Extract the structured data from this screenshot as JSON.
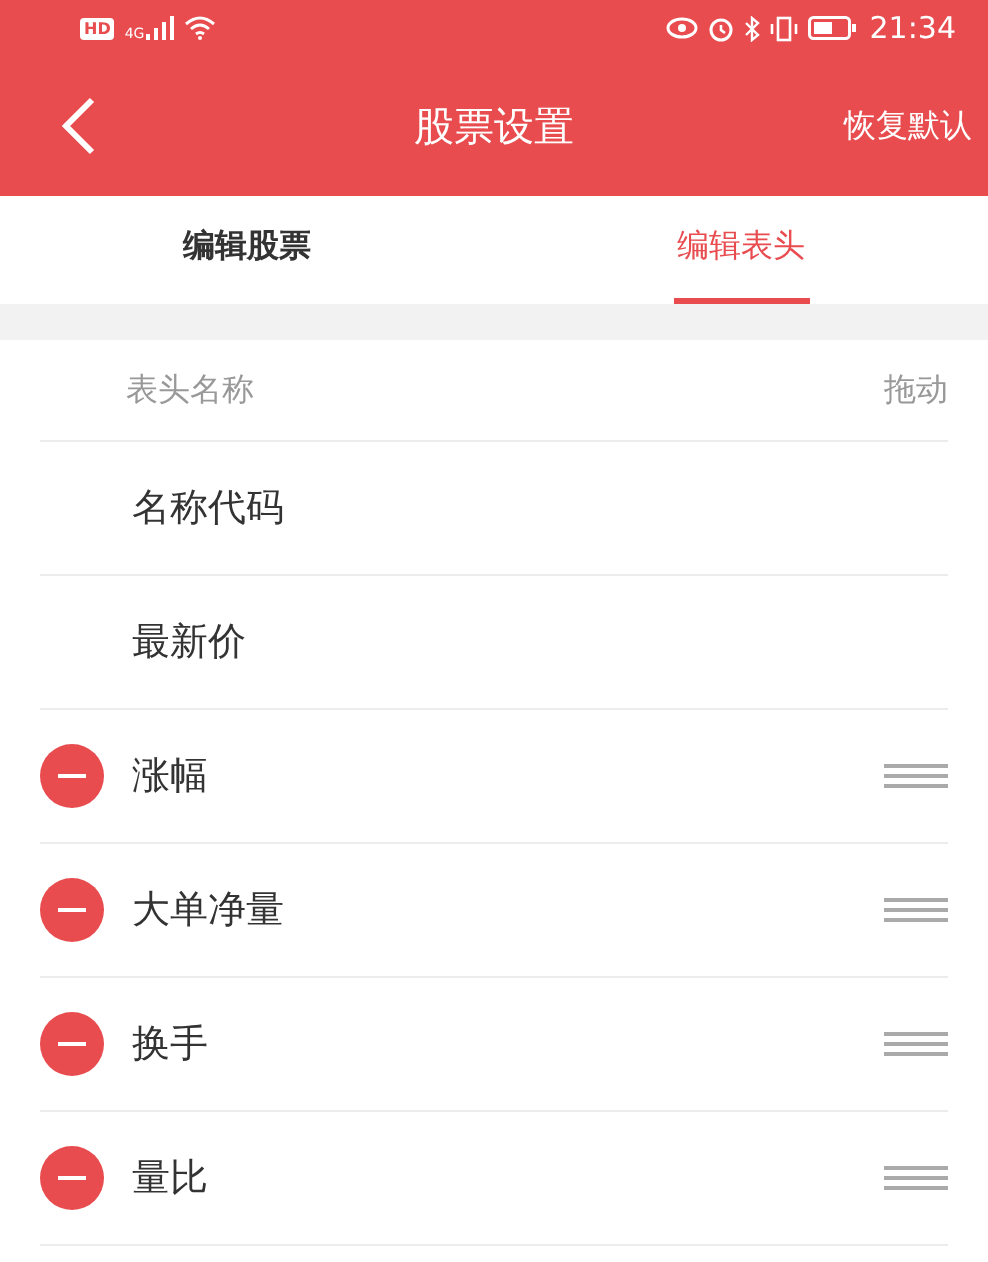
{
  "status_bar": {
    "hd": "HD",
    "network": "4G",
    "time": "21:34"
  },
  "header": {
    "title": "股票设置",
    "action": "恢复默认"
  },
  "tabs": [
    {
      "label": "编辑股票",
      "selected": false
    },
    {
      "label": "编辑表头",
      "selected": true
    }
  ],
  "list_header": {
    "name": "表头名称",
    "drag": "拖动"
  },
  "rows": [
    {
      "label": "名称代码",
      "removable": false
    },
    {
      "label": "最新价",
      "removable": false
    },
    {
      "label": "涨幅",
      "removable": true
    },
    {
      "label": "大单净量",
      "removable": true
    },
    {
      "label": "换手",
      "removable": true
    },
    {
      "label": "量比",
      "removable": true
    }
  ]
}
